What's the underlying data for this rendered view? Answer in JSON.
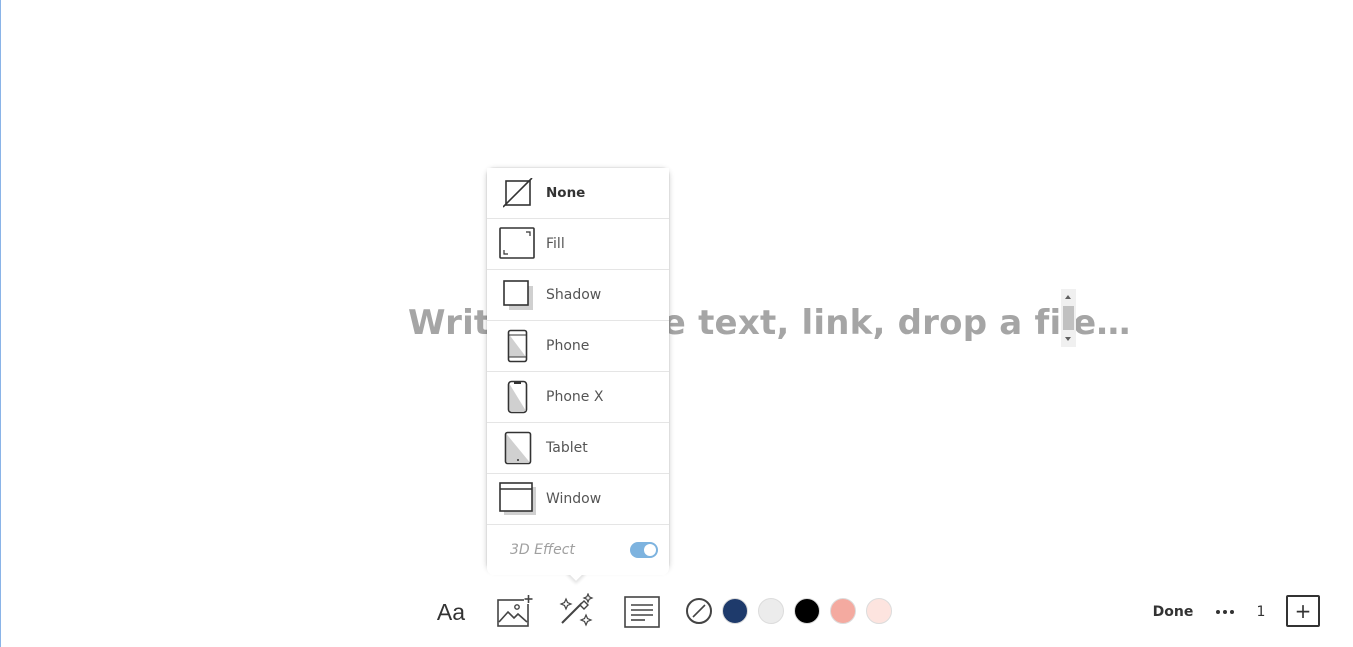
{
  "canvas": {
    "placeholder": "Write or paste text, link, drop a file…"
  },
  "frame_menu": {
    "items": [
      {
        "label": "None",
        "icon": "no-frame-icon",
        "selected": true
      },
      {
        "label": "Fill",
        "icon": "fill-frame-icon",
        "selected": false
      },
      {
        "label": "Shadow",
        "icon": "shadow-frame-icon",
        "selected": false
      },
      {
        "label": "Phone",
        "icon": "phone-frame-icon",
        "selected": false
      },
      {
        "label": "Phone X",
        "icon": "phone-x-frame-icon",
        "selected": false
      },
      {
        "label": "Tablet",
        "icon": "tablet-frame-icon",
        "selected": false
      },
      {
        "label": "Window",
        "icon": "window-frame-icon",
        "selected": false
      }
    ],
    "effect_label": "3D Effect",
    "effect_enabled": true
  },
  "toolbar": {
    "text_style_label": "Aa",
    "icons": [
      "add-image-icon",
      "magic-wand-icon",
      "text-align-icon"
    ],
    "swatches": [
      {
        "name": "none",
        "color": "#ffffff"
      },
      {
        "name": "navy",
        "color": "#1e3a6b"
      },
      {
        "name": "light-gray",
        "color": "#ececec"
      },
      {
        "name": "black",
        "color": "#000000"
      },
      {
        "name": "salmon",
        "color": "#f4aaa0"
      },
      {
        "name": "blush",
        "color": "#fde4df"
      }
    ]
  },
  "right_controls": {
    "done_label": "Done",
    "page_number": "1",
    "add_label": "+"
  }
}
